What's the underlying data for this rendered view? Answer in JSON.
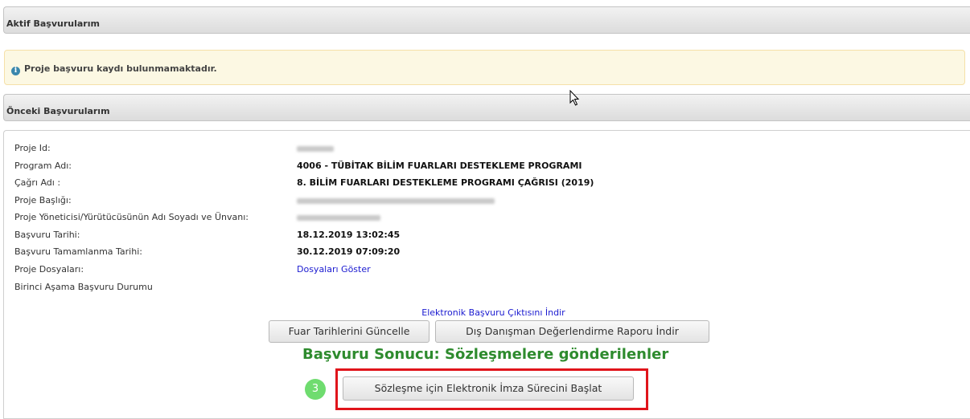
{
  "active": {
    "header": "Aktif Başvurularım",
    "alert_text": "Proje başvuru kaydı bulunmamaktadır."
  },
  "previous": {
    "header": "Önceki Başvurularım",
    "fields": [
      {
        "label": "Proje Id:",
        "value": ""
      },
      {
        "label": "Program Adı:",
        "value": "4006 - TÜBİTAK BİLİM FUARLARI DESTEKLEME PROGRAMI"
      },
      {
        "label": "Çağrı Adı :",
        "value": "8. BİLİM FUARLARI DESTEKLEME PROGRAMI ÇAĞRISI (2019)"
      },
      {
        "label": "Proje Başlığı:",
        "value": ""
      },
      {
        "label": "Proje Yöneticisi/Yürütücüsünün Adı Soyadı ve Ünvanı:",
        "value": ""
      },
      {
        "label": "Başvuru Tarihi:",
        "value": "18.12.2019 13:02:45"
      },
      {
        "label": "Başvuru Tamamlanma Tarihi:",
        "value": "30.12.2019 07:09:20"
      },
      {
        "label": "Proje Dosyaları:",
        "value": "Dosyaları Göster"
      },
      {
        "label": "Birinci Aşama Başvuru Durumu",
        "value": ""
      }
    ],
    "download_link": "Elektronik Başvuru Çıktısını İndir",
    "btn_update_dates": "Fuar Tarihlerini Güncelle",
    "btn_download_report": "Dış Danışman Değerlendirme Raporu İndir",
    "result_text": "Başvuru Sonucu: Sözleşmelere gönderilenler",
    "step_number": "3",
    "btn_start_esign": "Sözleşme için Elektronik İmza Sürecini Başlat"
  },
  "colors": {
    "link": "#1a1ad0",
    "result": "#2e8b2e",
    "highlight": "#e0141b",
    "step_badge": "#6fdc6f"
  }
}
